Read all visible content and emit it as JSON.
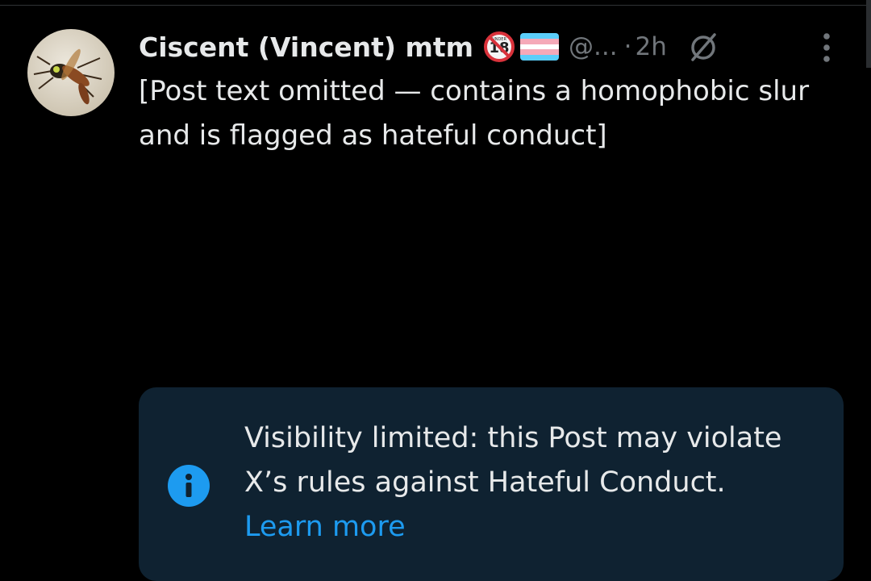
{
  "post": {
    "author_name": "Ciscent (Vincent) mtm",
    "handle": "@...",
    "separator": "·",
    "time": "2h",
    "badges": [
      "under-18-icon",
      "trans-flag-icon"
    ],
    "body": "[Post text omitted — contains a homophobic slur and is flagged as hateful conduct]",
    "more_icon": "more-vertical-icon",
    "status_icon": "null-sign-icon"
  },
  "notice": {
    "text": "Visibility limited: this Post may violate X’s rules against Hateful Conduct.",
    "link_label": "Learn more",
    "icon": "info-icon"
  },
  "colors": {
    "background": "#000000",
    "text": "#e7e9ea",
    "muted": "#71767b",
    "accent": "#1d9bf0",
    "notice_bg": "#0f2231"
  }
}
